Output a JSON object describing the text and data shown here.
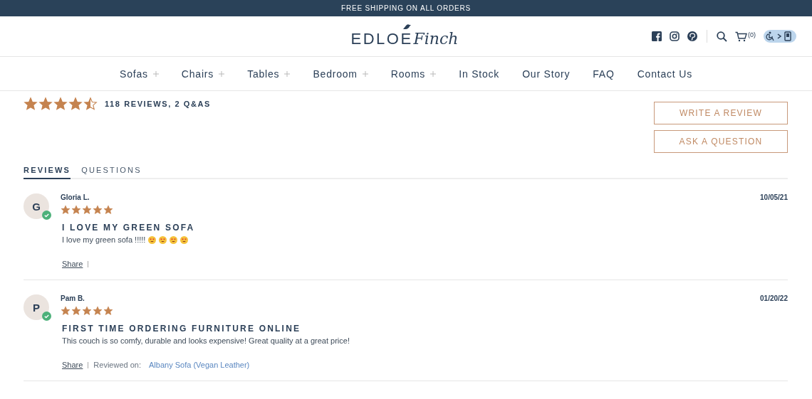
{
  "banner": "FREE SHIPPING ON ALL ORDERS",
  "logo": {
    "wordmark": "EDLOE",
    "script": "Finch"
  },
  "cart_count": "(0)",
  "nav": [
    {
      "label": "Sofas",
      "has_submenu": true
    },
    {
      "label": "Chairs",
      "has_submenu": true
    },
    {
      "label": "Tables",
      "has_submenu": true
    },
    {
      "label": "Bedroom",
      "has_submenu": true
    },
    {
      "label": "Rooms",
      "has_submenu": true
    },
    {
      "label": "In Stock",
      "has_submenu": false
    },
    {
      "label": "Our Story",
      "has_submenu": false
    },
    {
      "label": "FAQ",
      "has_submenu": false
    },
    {
      "label": "Contact Us",
      "has_submenu": false
    }
  ],
  "summary": {
    "stars": 4.5,
    "count": "118 REVIEWS, 2 Q&AS"
  },
  "buttons": [
    "WRITE A REVIEW",
    "ASK A QUESTION"
  ],
  "tabs": [
    {
      "label": "REVIEWS",
      "selected": true
    },
    {
      "label": "QUESTIONS",
      "selected": false
    }
  ],
  "reviews": [
    {
      "initial": "G",
      "verified": true,
      "name": "Gloria L.",
      "stars": 5,
      "date": "10/05/21",
      "title": "I LOVE MY GREEN SOFA",
      "body": "I love my green sofa !!!!!",
      "heart_eyes_emojis": true,
      "share": "Share"
    },
    {
      "initial": "P",
      "verified": true,
      "name": "Pam B.",
      "stars": 5,
      "date": "01/20/22",
      "title": "FIRST TIME ORDERING FURNITURE ONLINE",
      "body": "This couch is so comfy, durable and looks expensive! Great quality at a great price!",
      "heart_eyes_emojis": false,
      "share": "Share",
      "reviewed_on_label": "Reviewed on:",
      "product": "Albany Sofa (Vegan Leather)"
    }
  ]
}
